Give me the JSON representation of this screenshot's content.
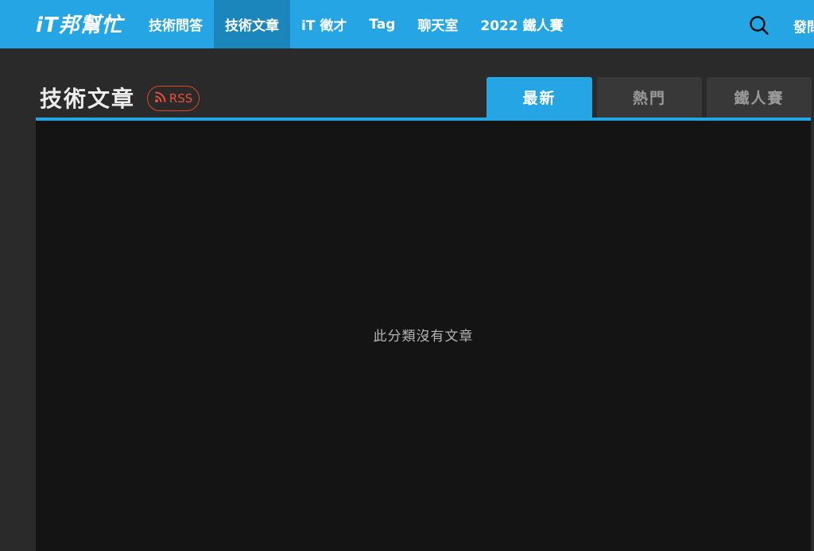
{
  "navbar": {
    "logo_text": "iT邦幫忙",
    "items": [
      {
        "label": "技術問答",
        "active": false
      },
      {
        "label": "技術文章",
        "active": true
      },
      {
        "label": "iT 徵才",
        "active": false
      },
      {
        "label": "Tag",
        "active": false
      },
      {
        "label": "聊天室",
        "active": false
      },
      {
        "label": "2022 鐵人賽",
        "active": false
      }
    ],
    "cut_item": "發問",
    "search_icon": "search-icon",
    "brand_color": "#25a5e4"
  },
  "header": {
    "title": "技術文章",
    "rss_label": "RSS"
  },
  "tabs": [
    {
      "label": "最新",
      "active": true
    },
    {
      "label": "熱門",
      "active": false
    },
    {
      "label": "鐵人賽",
      "active": false
    }
  ],
  "content": {
    "empty_message": "此分類沒有文章"
  }
}
